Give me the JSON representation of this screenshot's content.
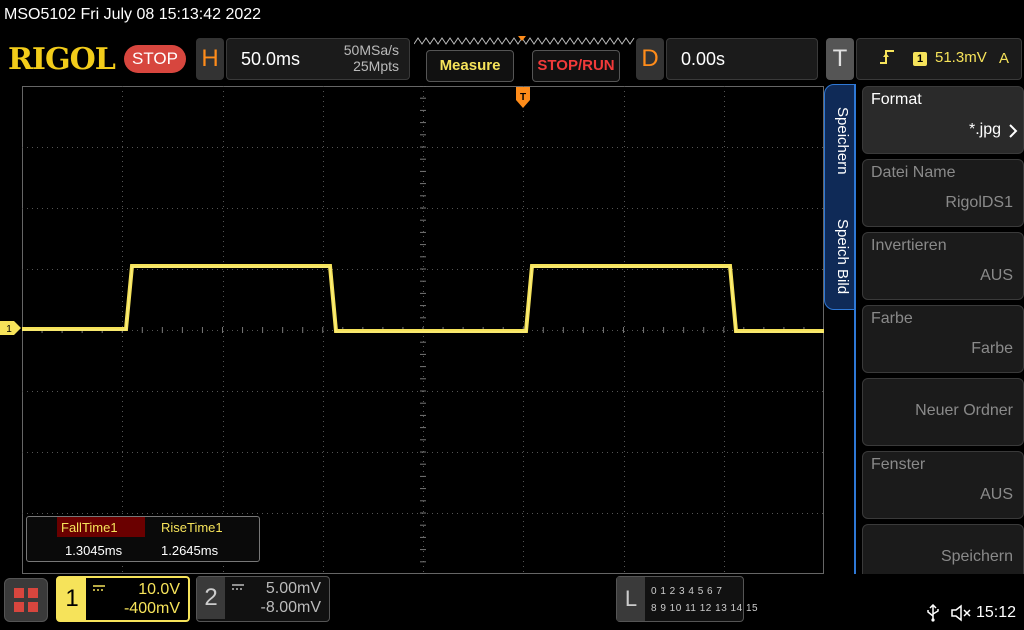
{
  "status_bar": {
    "title": "MSO5102  Fri July 08 15:13:42 2022"
  },
  "header": {
    "logo": "RIGOL",
    "run_state": "STOP",
    "horizontal": {
      "letter": "H",
      "timebase": "50.0ms",
      "sample_rate": "50MSa/s",
      "memory_depth": "25Mpts"
    },
    "measure_button": "Measure",
    "stoprun_button": "STOP/RUN",
    "delay": {
      "letter": "D",
      "value": "0.00s"
    },
    "trigger": {
      "letter": "T",
      "edge_icon": "rising-edge-icon",
      "source": "1",
      "level": "51.3mV",
      "mode": "A"
    }
  },
  "screen": {
    "trigger_marker": "T",
    "ch1_marker": "1",
    "waveform_color": "#f6e35a"
  },
  "measurements": [
    {
      "name": "FallTime1",
      "value": "1.3045ms"
    },
    {
      "name": "RiseTime1",
      "value": "1.2645ms"
    }
  ],
  "menu": {
    "tabs": [
      "Speichern",
      "Speich Bild"
    ],
    "items": [
      {
        "label": "Format",
        "value": "*.jpg",
        "enabled": true
      },
      {
        "label": "Datei Name",
        "value": "RigolDS1",
        "enabled": false
      },
      {
        "label": "Invertieren",
        "value": "AUS",
        "enabled": false
      },
      {
        "label": "Farbe",
        "value": "Farbe",
        "enabled": false
      },
      {
        "label": "",
        "value": "Neuer Ordner",
        "enabled": false
      },
      {
        "label": "Fenster",
        "value": "AUS",
        "enabled": false
      },
      {
        "label": "",
        "value": "Speichern",
        "enabled": false
      }
    ]
  },
  "channels": {
    "ch1": {
      "num": "1",
      "scale": "10.0V",
      "offset": "-400mV",
      "color": "#f6e35a"
    },
    "ch2": {
      "num": "2",
      "scale": "5.00mV",
      "offset": "-8.00mV"
    }
  },
  "logic": {
    "letter": "L",
    "row1": "0 1 2 3  4 5 6 7",
    "row2": "8 9 10 11 12 13 14 15"
  },
  "system": {
    "time": "15:12"
  }
}
